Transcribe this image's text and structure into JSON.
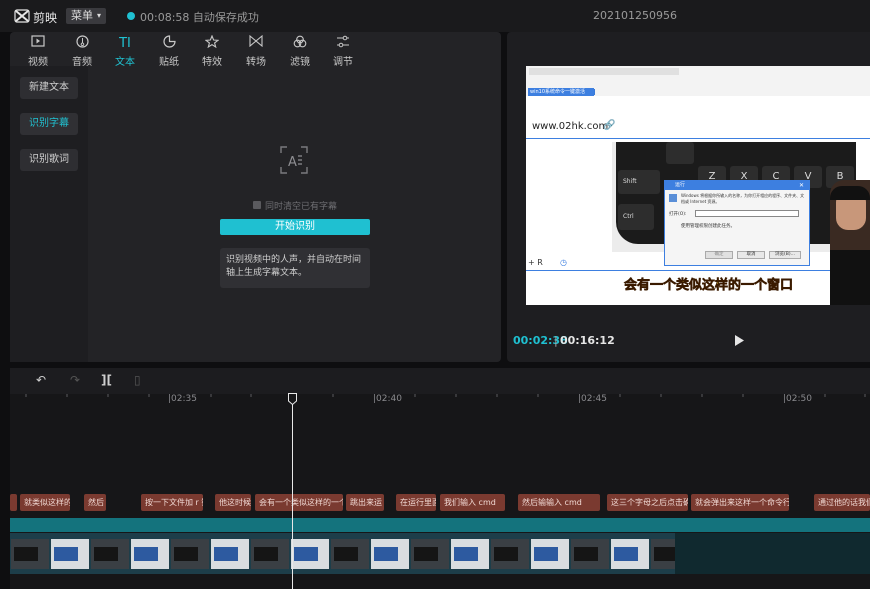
{
  "topbar": {
    "app_name": "剪映",
    "menu_label": "菜单",
    "save_status": "00:08:58 自动保存成功",
    "project_name": "202101250956"
  },
  "toolbar": {
    "items": [
      {
        "label": "视频",
        "icon": "video-icon"
      },
      {
        "label": "音频",
        "icon": "audio-icon"
      },
      {
        "label": "文本",
        "icon": "text-icon",
        "glyph": "TI"
      },
      {
        "label": "贴纸",
        "icon": "sticker-icon"
      },
      {
        "label": "特效",
        "icon": "effects-icon"
      },
      {
        "label": "转场",
        "icon": "transition-icon"
      },
      {
        "label": "滤镜",
        "icon": "filter-icon"
      },
      {
        "label": "调节",
        "icon": "adjust-icon"
      }
    ],
    "active_index": 2
  },
  "sidebar": {
    "items": [
      {
        "label": "新建文本"
      },
      {
        "label": "识别字幕"
      },
      {
        "label": "识别歌词"
      }
    ],
    "active_index": 1
  },
  "caption_panel": {
    "clear_label": "同时清空已有字幕",
    "start_button": "开始识别",
    "hint": "识别视频中的人声，并自动在时间轴上生成字幕文本。"
  },
  "preview": {
    "time_current": "00:02:38",
    "time_separator": "|",
    "time_total": "00:16:12",
    "frame": {
      "browser_tab": "win10系统命令一键激活",
      "url_text": "www.02hk.com",
      "dialog_title": "运行",
      "dialog_text": "Windows 将根据你所输入的名称，为你打开相应的程序、文件夹、文档或 Internet 资源。",
      "dialog_open_label": "打开(O):",
      "dialog_admin_text": "使用管理权限创建此任务。",
      "dialog_ok": "确定",
      "dialog_cancel": "取消",
      "dialog_browse": "浏览(B)...",
      "keys": [
        "Z",
        "X",
        "C",
        "V",
        "B",
        "Shift",
        "Ctrl"
      ],
      "shortcut_text": "+ R",
      "subtitle": "会有一个类似这样的一个窗口"
    }
  },
  "timeline": {
    "ticks": [
      "|02:35",
      "|02:40",
      "|02:45",
      "|02:50"
    ],
    "subtitles": [
      "就类似这样的",
      "然后",
      "按一下文件加 r 键",
      "他这时候",
      "会有一个类似这样的一个窗口",
      "跳出来运",
      "在运行里面",
      "我们输入 cmd",
      "然后输输入 cmd",
      "这三个字母之后点击确定",
      "就会弹出来这样一个命令行窗口",
      "通过他的话我们"
    ]
  },
  "colors": {
    "accent": "#1fc0d1",
    "subtitle_clip": "#7a3a30",
    "audio_track": "#14737d"
  }
}
